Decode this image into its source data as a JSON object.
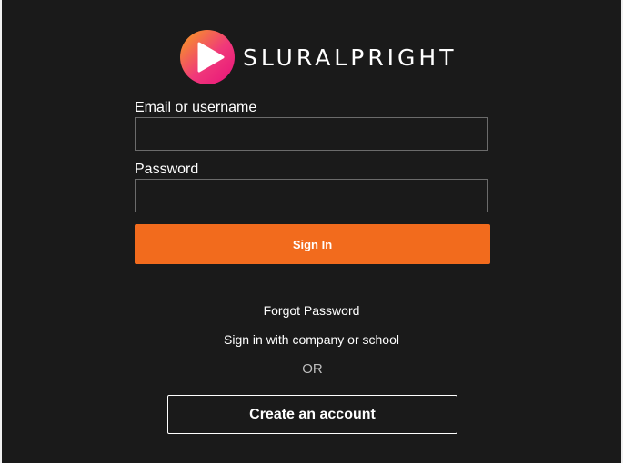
{
  "brand": {
    "name": "SLURALPRIGHT",
    "logo_icon": "play-icon",
    "gradient_start": "#f7a21b",
    "gradient_end": "#e8127a"
  },
  "form": {
    "email_label": "Email or username",
    "email_value": "",
    "password_label": "Password",
    "password_value": "",
    "sign_in_label": "Sign In"
  },
  "links": {
    "forgot_password": "Forgot Password",
    "company_sign_in": "Sign in with company or school"
  },
  "divider": {
    "text": "OR"
  },
  "create_account_label": "Create an account",
  "colors": {
    "background": "#1a1a1a",
    "accent": "#f26b1d",
    "text": "#ffffff",
    "input_border": "#6b6b6b"
  }
}
